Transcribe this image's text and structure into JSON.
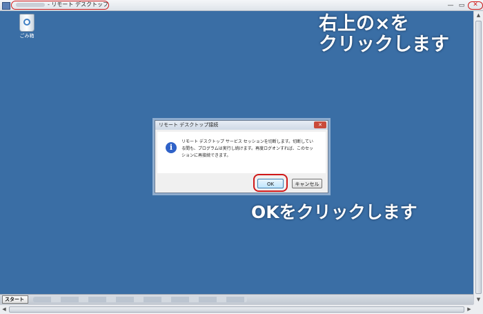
{
  "window": {
    "title": "- リモート デスクトップ接続",
    "minimize_glyph": "—",
    "maximize_glyph": "▭",
    "close_glyph": "✕"
  },
  "desktop": {
    "recycle_bin_label": "ごみ箱"
  },
  "instructions": {
    "close_line1": "右上の×を",
    "close_line2": "クリックします",
    "ok_hint": "OKをクリックします"
  },
  "dialog": {
    "title": "リモート デスクトップ接続",
    "close_glyph": "✕",
    "icon": "information-icon",
    "message": "リモート デスクトップ サービス セッションを切断します。切断している間も、プログラムは実行し続けます。再度ログオンすれば、このセッションに再接続できます。",
    "ok_label": "OK",
    "cancel_label": "キャンセル"
  },
  "taskbar": {
    "start_label": "スタート"
  },
  "colors": {
    "desktop": "#3a6ea5",
    "highlight_ring": "#d01818"
  }
}
